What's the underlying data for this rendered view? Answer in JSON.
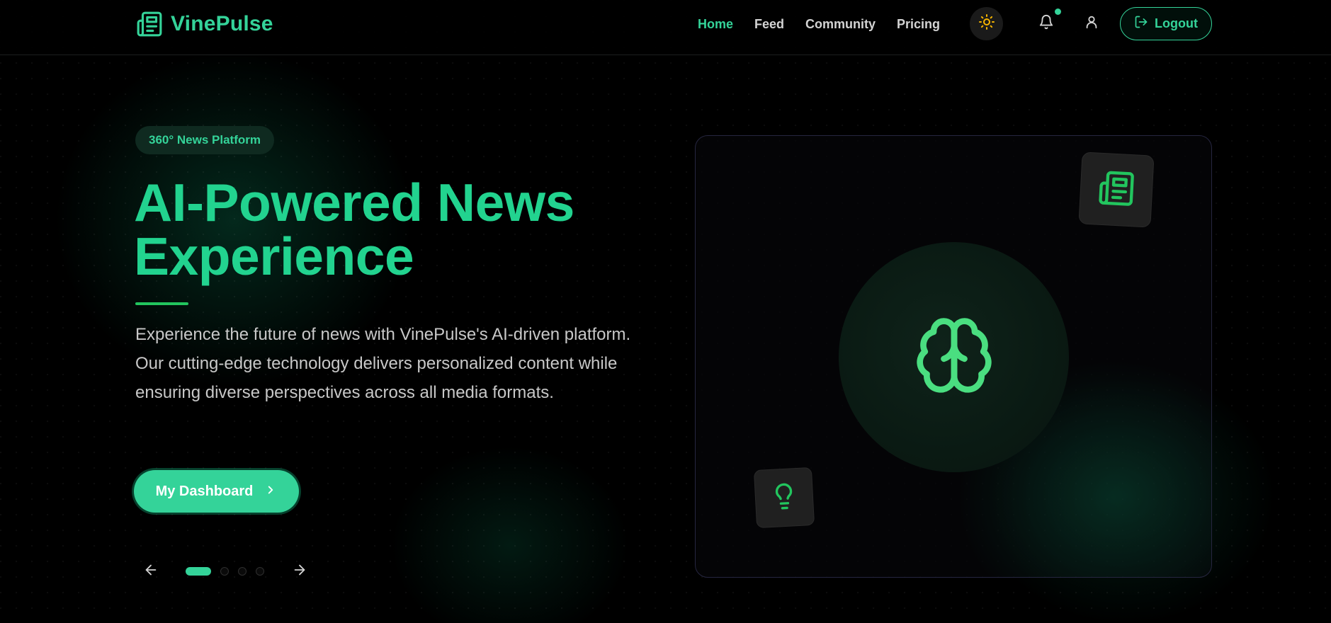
{
  "app": {
    "name": "VinePulse"
  },
  "nav": {
    "links": [
      {
        "label": "Home",
        "active": true
      },
      {
        "label": "Feed",
        "active": false
      },
      {
        "label": "Community",
        "active": false
      },
      {
        "label": "Pricing",
        "active": false
      }
    ],
    "logout_label": "Logout",
    "has_notification": true
  },
  "hero": {
    "badge": "360° News Platform",
    "title_line1": "AI-Powered News",
    "title_line2": "Experience",
    "description": "Experience the future of news with VinePulse's AI-driven platform. Our cutting-edge technology delivers personalized content while ensuring diverse perspectives across all media formats.",
    "cta_label": "My Dashboard",
    "slides": {
      "count": 4,
      "active_index": 0
    }
  },
  "icons": {
    "brand": "newspaper-icon",
    "theme_toggle": "sun-icon",
    "notifications": "bell-icon",
    "profile": "user-icon",
    "logout": "logout-icon",
    "cta": "chevron-right-icon",
    "prev": "arrow-left-icon",
    "next": "arrow-right-icon",
    "card_center": "brain-icon",
    "card_tile_top": "newspaper-icon",
    "card_tile_bottom": "lightbulb-icon"
  },
  "colors": {
    "accent": "#34d399",
    "accent_dark": "#22c55e",
    "sun": "#f5b400",
    "background": "#000000"
  }
}
